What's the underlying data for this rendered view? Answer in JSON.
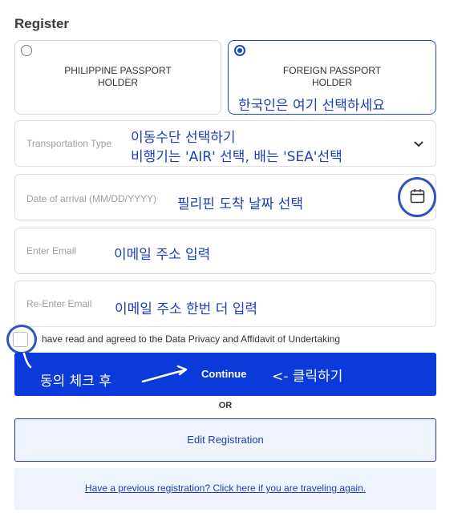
{
  "form": {
    "title": "Register",
    "holder_options": [
      {
        "label": "PHILIPPINE PASSPORT\nHOLDER",
        "selected": false
      },
      {
        "label": "FOREIGN PASSPORT\nHOLDER",
        "selected": true
      }
    ],
    "transportation": {
      "placeholder": "Transportation Type"
    },
    "arrival": {
      "placeholder": "Date of arrival (MM/DD/YYYY)"
    },
    "email": {
      "placeholder": "Enter Email"
    },
    "reemail": {
      "placeholder": "Re-Enter Email"
    },
    "agree_text": "have read and agreed to the Data Privacy and Affidavit of Undertaking",
    "continue_label": "Continue",
    "or_label": "OR",
    "edit_label": "Edit Registration",
    "previous_link": "Have a previous registration? Click here if you are traveling again."
  },
  "annotations": {
    "select_here": "한국인은 여기 선택하세요",
    "transport_line1": "이동수단 선택하기",
    "transport_line2": "비행기는 'AIR' 선택,   배는 'SEA'선택",
    "arrival_note": "필리핀 도착 날짜 선택",
    "email_note": "이메일 주소 입력",
    "reemail_note": "이메일 주소 한번 더 입력",
    "agree_note": "동의 체크 후",
    "click_note": "<- 클릭하기"
  },
  "colors": {
    "primary": "#0a3ad9",
    "annotation": "#1d3fb8",
    "border_selected": "#2148c4"
  },
  "icons": [
    "chevron-down-icon",
    "calendar-icon"
  ]
}
